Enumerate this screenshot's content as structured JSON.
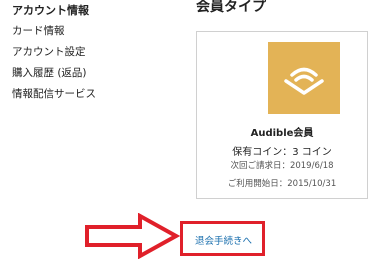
{
  "sidebar": {
    "title": "アカウント情報",
    "items": [
      {
        "label": "カード情報"
      },
      {
        "label": "アカウント設定"
      },
      {
        "label": "購入履歴 (返品)"
      },
      {
        "label": "情報配信サービス"
      }
    ]
  },
  "membership": {
    "section_title": "会員タイプ",
    "logo_icon": "audible-logo-icon",
    "plan_name": "Audible会員",
    "coins": "保有コイン：3 コイン",
    "next_billing": "次回ご請求日：2019/6/18",
    "start_date": "ご利用開始日：2015/10/31"
  },
  "cancel": {
    "link_label": "退会手続きへ"
  },
  "colors": {
    "logo_bg": "#e3b356",
    "highlight": "#e0202a",
    "link": "#1a6fae"
  }
}
